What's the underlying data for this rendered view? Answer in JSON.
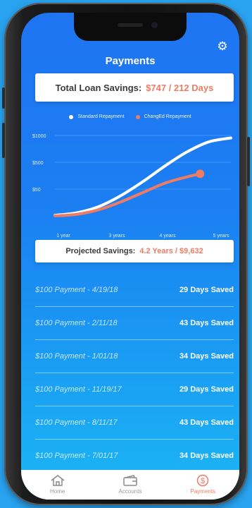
{
  "header": {
    "title": "Payments",
    "settings_icon": "gear-icon"
  },
  "total_savings": {
    "label": "Total Loan Savings:",
    "value": "$747 / 212 Days"
  },
  "chart_data": {
    "type": "line",
    "legend": [
      {
        "name": "Standard Repayment",
        "color": "#ffffff"
      },
      {
        "name": "ChangEd Repayment",
        "color": "#ef7b63"
      }
    ],
    "y_ticks": [
      "$1000",
      "$500",
      "$50"
    ],
    "x_ticks": [
      "1 year",
      "3 years",
      "4 years",
      "5 years"
    ],
    "series": [
      {
        "name": "Standard Repayment",
        "color": "#ffffff",
        "points": [
          [
            1,
            8
          ],
          [
            1.5,
            40
          ],
          [
            2,
            120
          ],
          [
            2.5,
            260
          ],
          [
            3,
            440
          ],
          [
            3.5,
            640
          ],
          [
            4,
            820
          ],
          [
            4.5,
            950
          ],
          [
            5,
            1000
          ]
        ]
      },
      {
        "name": "ChangEd Repayment",
        "color": "#ef7b63",
        "points": [
          [
            1,
            0
          ],
          [
            1.5,
            20
          ],
          [
            2,
            80
          ],
          [
            2.5,
            180
          ],
          [
            3,
            300
          ],
          [
            3.5,
            420
          ],
          [
            4,
            500
          ],
          [
            4.3,
            540
          ]
        ]
      }
    ],
    "xlim": [
      1,
      5
    ],
    "ylim": [
      0,
      1050
    ]
  },
  "projected": {
    "label": "Projected Savings:",
    "value": "4.2 Years / $9,632"
  },
  "payments": [
    {
      "desc": "$100 Payment - 4/19/18",
      "saved": "29 Days Saved"
    },
    {
      "desc": "$100 Payment - 2/11/18",
      "saved": "43 Days Saved"
    },
    {
      "desc": "$100 Payment - 1/01/18",
      "saved": "34 Days Saved"
    },
    {
      "desc": "$100 Payment - 11/19/17",
      "saved": "29 Days Saved"
    },
    {
      "desc": "$100 Payment - 8/11/17",
      "saved": "43 Days Saved"
    },
    {
      "desc": "$100 Payment - 7/01/17",
      "saved": "34 Days Saved"
    }
  ],
  "tabs": [
    {
      "label": "Home",
      "icon": "home-icon",
      "active": false
    },
    {
      "label": "Accounts",
      "icon": "wallet-icon",
      "active": false
    },
    {
      "label": "Payments",
      "icon": "dollar-icon",
      "active": true
    }
  ],
  "colors": {
    "accent": "#ef7b63",
    "screen_blue": "#1f74f2"
  }
}
